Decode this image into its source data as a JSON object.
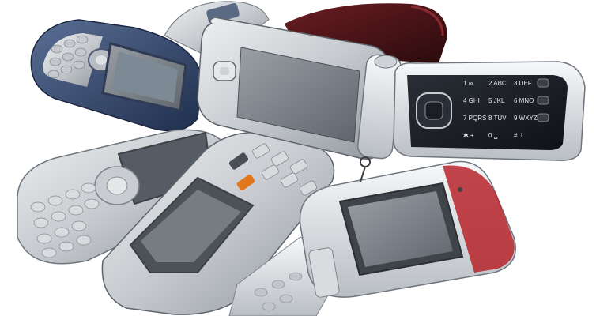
{
  "photo": {
    "background": "#ffffff",
    "colors": {
      "silver": "#c9ccd0",
      "silver_dark": "#8e949b",
      "chrome": "#e6e8ea",
      "navy": "#2b3d63",
      "black_keypad": "#15181d",
      "screen_grey": "#6e737a",
      "screen_blue_grey": "#7d8a96",
      "maroon": "#4a1518",
      "orange_key": "#e2761d",
      "red_accent": "#b6242a"
    },
    "keypad_center": {
      "keys": [
        "1 ∞",
        "2 ABC",
        "3 DEF",
        "4 GHI",
        "5 JKL",
        "6 MNO",
        "7 PQRS",
        "8 TUV",
        "9 WXYZ",
        "✱ +",
        "0 ␣",
        "# ⇧"
      ]
    },
    "icons": [
      "silver-flip-phone-icon",
      "navy-slider-phone-icon",
      "grey-candybar-phone-icon",
      "rugged-phone-icon",
      "small-flip-phone-icon",
      "maroon-phone-icon"
    ]
  }
}
